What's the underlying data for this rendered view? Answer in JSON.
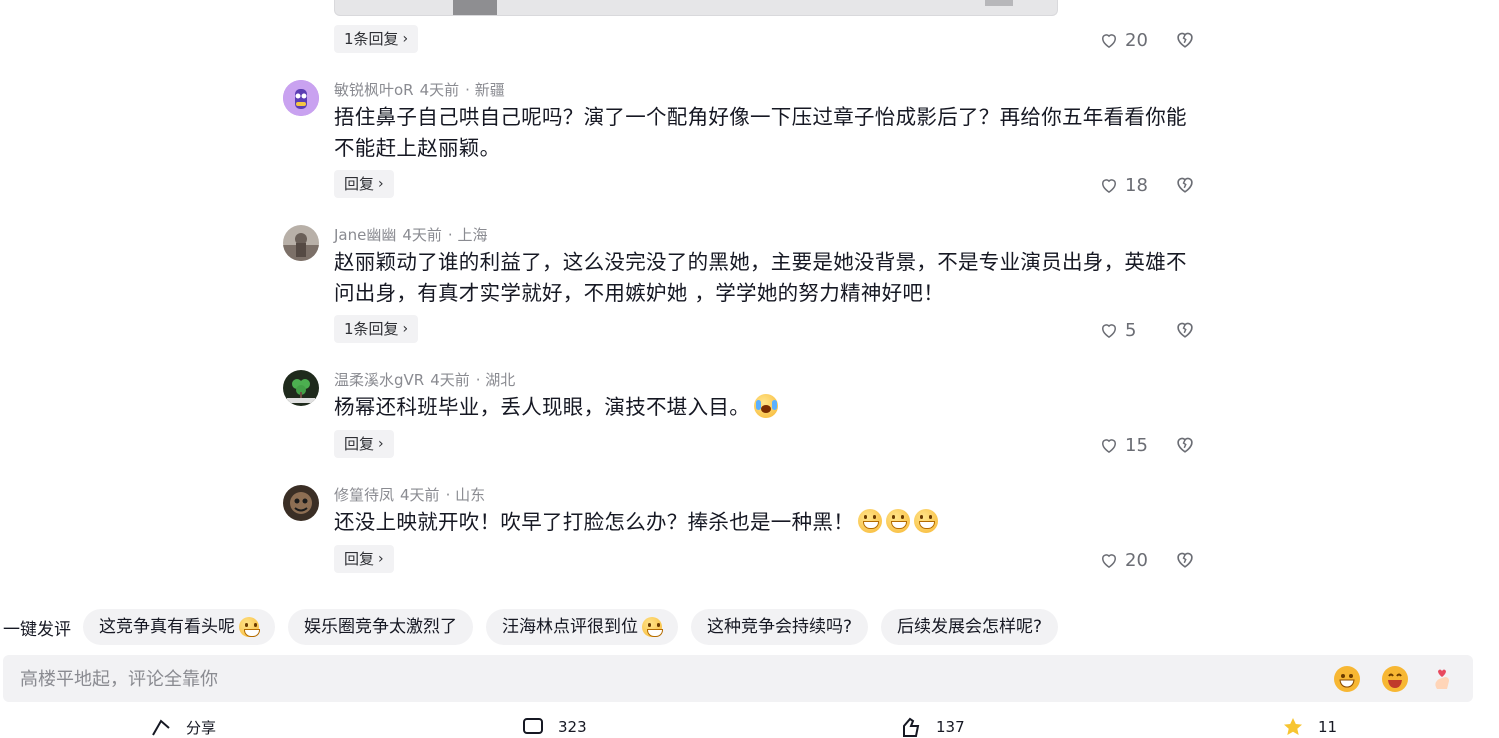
{
  "top_comment_tail": {
    "reply_label": "1条回复",
    "likes": "20"
  },
  "comments": [
    {
      "username": "敏锐枫叶oR",
      "time": "4天前",
      "location": "· 新疆",
      "text": "捂住鼻子自己哄自己呢吗？演了一个配角好像一下压过章子怡成影后了？再给你五年看看你能不能赶上赵丽颖。",
      "reply_label": "回复",
      "likes": "18",
      "avatar_color": "#b784e8"
    },
    {
      "username": "Jane幽幽",
      "time": "4天前",
      "location": "· 上海",
      "text": "赵丽颖动了谁的利益了，这么没完没了的黑她，主要是她没背景，不是专业演员出身，英雄不问出身，有真才实学就好，不用嫉妒她 ，学学她的努力精神好吧！",
      "reply_label": "1条回复",
      "likes": "5",
      "avatar_color": "#9a8f86"
    },
    {
      "username": "温柔溪水gVR",
      "time": "4天前",
      "location": "· 湖北",
      "text": "杨幂还科班毕业，丢人现眼，演技不堪入目。",
      "reply_label": "回复",
      "likes": "15",
      "avatar_color": "#2e3b2a"
    },
    {
      "username": "修篁待凤",
      "time": "4天前",
      "location": "· 山东",
      "text": "还没上映就开吹！吹早了打脸怎么办？捧杀也是一种黑！",
      "reply_label": "回复",
      "likes": "20",
      "avatar_color": "#5a4a3a"
    }
  ],
  "quick_comment": {
    "label": "一键发评",
    "chips": [
      "这竞争真有看头呢",
      "娱乐圈竞争太激烈了",
      "汪海林点评很到位",
      "这种竞争会持续吗?",
      "后续发展会怎样呢?"
    ]
  },
  "input": {
    "placeholder": "高楼平地起，评论全靠你"
  },
  "bottom_bar": {
    "share": "分享",
    "comments": "323",
    "likes": "137",
    "favorites": "11"
  },
  "colors": {
    "chip_bg": "#f2f2f4",
    "meta_text": "#8a8b91",
    "body_text": "#161823"
  },
  "icons": [
    "heart-icon",
    "dislike-icon",
    "chevron-right-icon",
    "grin-emoji-icon",
    "laugh-emoji-icon",
    "finger-heart-icon",
    "share-icon",
    "comment-icon",
    "like-icon",
    "star-icon"
  ]
}
